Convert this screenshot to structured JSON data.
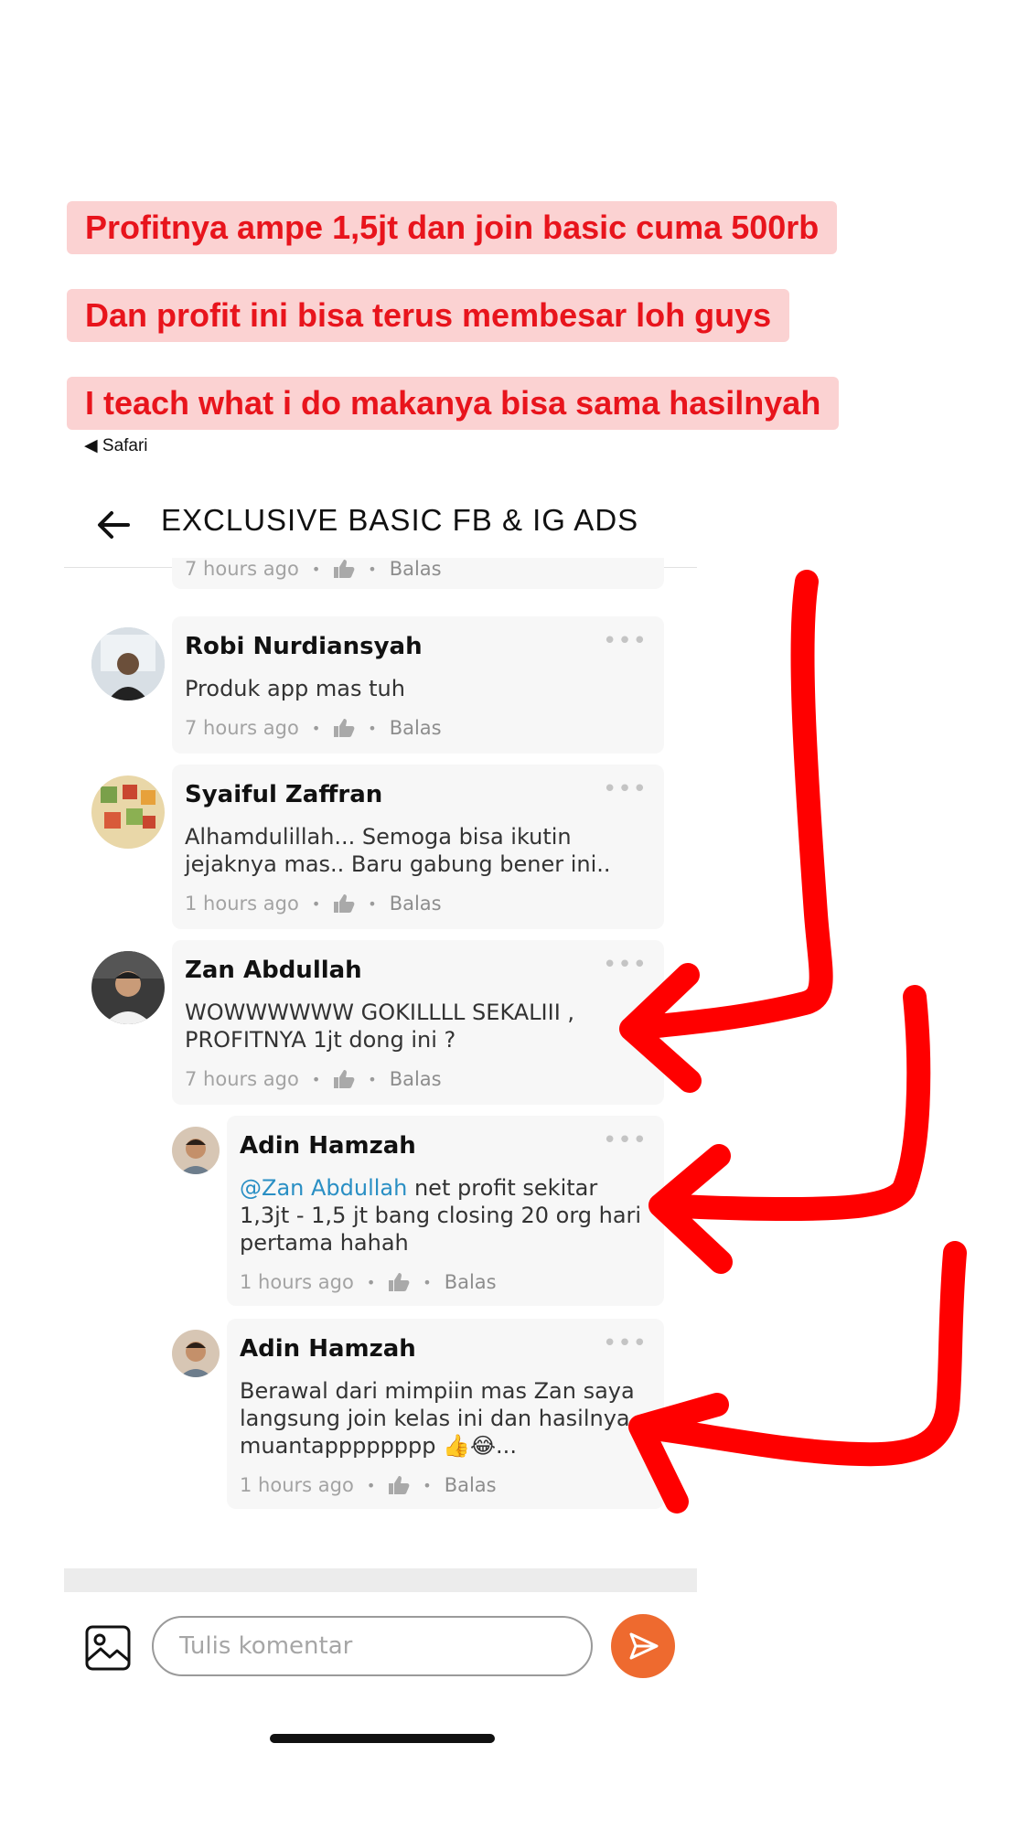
{
  "banners": [
    "Profitnya ampe 1,5jt dan join basic cuma 500rb",
    "Dan profit ini bisa terus membesar loh guys",
    "I teach what i do makanya bisa sama hasilnyah"
  ],
  "status": {
    "back_app": "◀ Safari"
  },
  "header": {
    "title": "EXCLUSIVE BASIC FB & IG ADS"
  },
  "partial_comment": {
    "time": "7 hours ago",
    "reply_label": "Balas"
  },
  "comments": [
    {
      "name": "Robi Nurdiansyah",
      "text": "Produk app mas tuh",
      "time": "7 hours ago",
      "reply_label": "Balas"
    },
    {
      "name": "Syaiful Zaffran",
      "text": "Alhamdulillah... Semoga bisa ikutin jejaknya mas.. Baru gabung bener ini..",
      "time": "1 hours ago",
      "reply_label": "Balas"
    },
    {
      "name": "Zan Abdullah",
      "text": "WOWWWWWW GOKILLLL SEKALIII , PROFITNYA 1jt dong ini ?",
      "time": "7 hours ago",
      "reply_label": "Balas"
    }
  ],
  "replies": [
    {
      "name": "Adin Hamzah",
      "mention": "@Zan Abdullah",
      "text": " net profit sekitar 1,3jt - 1,5 jt bang closing 20 org hari pertama hahah",
      "time": "1 hours ago",
      "reply_label": "Balas"
    },
    {
      "name": "Adin Hamzah",
      "text": "Berawal dari mimpiin mas Zan saya langsung join kelas ini dan hasilnya muantapppppppp 👍😂...",
      "time": "1 hours ago",
      "reply_label": "Balas"
    }
  ],
  "composer": {
    "placeholder": "Tulis komentar"
  },
  "colors": {
    "banner_text": "#e8141c",
    "banner_bg": "#fbd2d2",
    "send_button": "#ee6a2f",
    "mention": "#2a8fc4",
    "arrow": "#ff0000"
  },
  "icons": [
    "back-arrow-icon",
    "like-icon",
    "more-dots-icon",
    "image-icon",
    "send-icon"
  ]
}
